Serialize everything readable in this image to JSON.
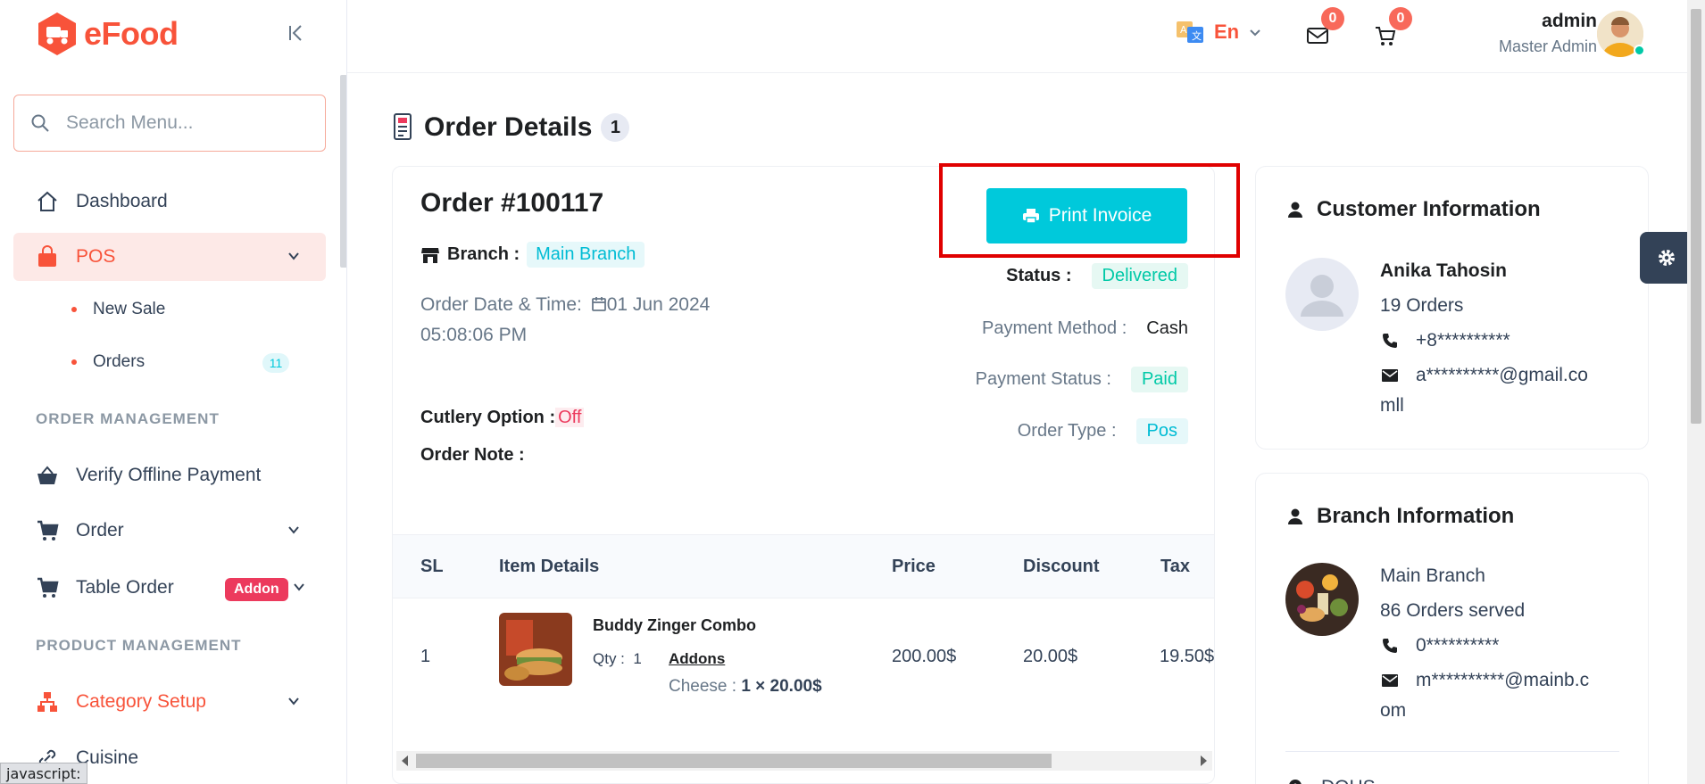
{
  "brand": {
    "name": "eFood"
  },
  "search": {
    "placeholder": "Search Menu..."
  },
  "sidebar": {
    "items": [
      {
        "label": "Dashboard",
        "icon": "home-icon"
      },
      {
        "label": "POS",
        "icon": "shopping-bag-icon",
        "active": true
      },
      {
        "label": "Verify Offline Payment",
        "icon": "basket-icon"
      },
      {
        "label": "Order",
        "icon": "cart-icon"
      },
      {
        "label": "Table Order",
        "icon": "cart-icon",
        "badge": "Addon"
      },
      {
        "label": "Category Setup",
        "icon": "category-icon"
      },
      {
        "label": "Cuisine",
        "icon": "link-icon"
      }
    ],
    "sub_items": [
      {
        "label": "New Sale"
      },
      {
        "label": "Orders",
        "badge": "11"
      }
    ],
    "sections": [
      "ORDER MANAGEMENT",
      "PRODUCT MANAGEMENT"
    ]
  },
  "header": {
    "language": "En",
    "messages_count": "0",
    "cart_count": "0",
    "user_name": "admin",
    "user_role": "Master Admin"
  },
  "page": {
    "title": "Order Details",
    "count": "1"
  },
  "order": {
    "number": "Order #100117",
    "branch_label": "Branch :",
    "branch": "Main Branch",
    "date_label": "Order Date & Time:",
    "date": "01 Jun 2024",
    "time": "05:08:06 PM",
    "cutlery_label": "Cutlery Option :",
    "cutlery_value": "Off",
    "note_label": "Order Note :",
    "print_label": "Print Invoice",
    "status_label": "Status :",
    "status": "Delivered",
    "payment_method_label": "Payment Method :",
    "payment_method": "Cash",
    "payment_status_label": "Payment Status :",
    "payment_status": "Paid",
    "order_type_label": "Order Type :",
    "order_type": "Pos"
  },
  "table": {
    "columns": [
      "SL",
      "Item Details",
      "Price",
      "Discount",
      "Tax"
    ],
    "rows": [
      {
        "sl": "1",
        "name": "Buddy Zinger Combo",
        "qty_label": "Qty :",
        "qty": "1",
        "addons_label": "Addons",
        "addon_name": "Cheese :",
        "addon_value": "1 × 20.00$",
        "price": "200.00$",
        "discount": "20.00$",
        "tax": "19.50$"
      }
    ]
  },
  "customer": {
    "title": "Customer Information",
    "name": "Anika Tahosin",
    "orders": "19 Orders",
    "phone": "+8**********",
    "email_line1": "a**********@gmail.co",
    "email_line2": "mll"
  },
  "branch_info": {
    "title": "Branch Information",
    "name": "Main Branch",
    "orders": "86 Orders served",
    "phone": "0**********",
    "email_line1": "m**********@mainb.c",
    "email_line2": "om",
    "footer_text": "DOHS"
  },
  "status_bar": {
    "text": "javascript:"
  },
  "colors": {
    "brand": "#f8533a",
    "accent": "#00c9db",
    "highlight": "#e00000"
  }
}
